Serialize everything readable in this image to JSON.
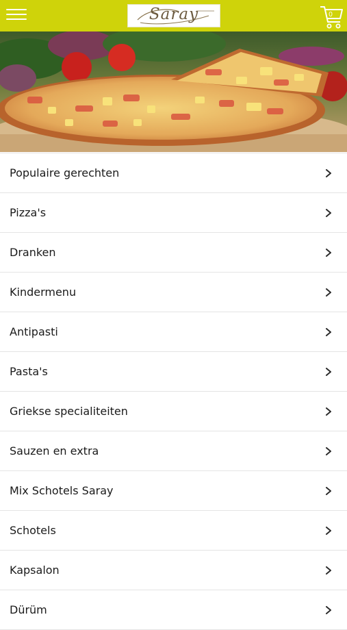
{
  "header": {
    "menu_icon": "hamburger-menu-icon",
    "logo_text": "Saray",
    "cart_icon": "shopping-cart-icon",
    "cart_count": "0",
    "background_color": "#cfd30a"
  },
  "hero": {
    "image": "pizza-hawaii-photo"
  },
  "menu": {
    "chevron_icon": "chevron-right-icon",
    "items": [
      {
        "label": "Populaire gerechten"
      },
      {
        "label": "Pizza's"
      },
      {
        "label": "Dranken"
      },
      {
        "label": "Kindermenu"
      },
      {
        "label": "Antipasti"
      },
      {
        "label": "Pasta's"
      },
      {
        "label": "Griekse specialiteiten"
      },
      {
        "label": "Sauzen en extra"
      },
      {
        "label": "Mix Schotels Saray"
      },
      {
        "label": "Schotels"
      },
      {
        "label": "Kapsalon"
      },
      {
        "label": "Dürüm"
      }
    ]
  }
}
